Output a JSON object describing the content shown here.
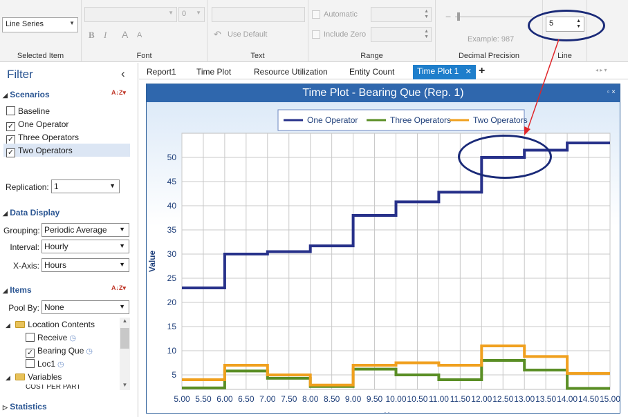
{
  "ribbon": {
    "selected_item": {
      "value": "Line Series",
      "label": "Selected Item"
    },
    "font": {
      "size_value": "0",
      "bold": "B",
      "italic": "I",
      "grow": "A",
      "shrink": "A",
      "label": "Font"
    },
    "text": {
      "use_default": "Use Default",
      "label": "Text"
    },
    "range": {
      "automatic": "Automatic",
      "include_zero": "Include Zero",
      "label": "Range"
    },
    "decimal": {
      "example": "Example: 987",
      "label": "Decimal Precision"
    },
    "line": {
      "value": "5",
      "label": "Line"
    }
  },
  "filter": {
    "title": "Filter",
    "collapse": "‹",
    "scenarios_label": "Scenarios",
    "sort_glyph": "A↓Z",
    "scenarios": [
      {
        "name": "Baseline",
        "checked": false
      },
      {
        "name": "One Operator",
        "checked": true
      },
      {
        "name": "Three Operators",
        "checked": true
      },
      {
        "name": "Two Operators",
        "checked": true,
        "selected": true
      }
    ],
    "replication_label": "Replication:",
    "replication_value": "1",
    "data_display_label": "Data Display",
    "grouping_label": "Grouping:",
    "grouping_value": "Periodic Average",
    "interval_label": "Interval:",
    "interval_value": "Hourly",
    "xaxis_label": "X-Axis:",
    "xaxis_value": "Hours",
    "items_label": "Items",
    "poolby_label": "Pool By:",
    "poolby_value": "None",
    "tree": {
      "location_contents": "Location Contents",
      "receive": "Receive",
      "bearing_que": "Bearing Que",
      "loc1": "Loc1",
      "variables": "Variables",
      "cost_per_part": "COST PER PART"
    },
    "statistics_label": "Statistics"
  },
  "tabs": [
    {
      "label": "Report1"
    },
    {
      "label": "Time Plot"
    },
    {
      "label": "Resource Utilization"
    },
    {
      "label": "Entity Count"
    },
    {
      "label": "Time Plot 1",
      "active": true
    }
  ],
  "tab_close": "✕",
  "tab_add": "+",
  "chart_data": {
    "type": "line",
    "title": "Time Plot - Bearing Que (Rep. 1)",
    "xlabel": "Hours",
    "ylabel": "Value",
    "xlim": [
      5.0,
      15.0
    ],
    "ylim": [
      2,
      55
    ],
    "xticks": [
      "5.00",
      "5.50",
      "6.00",
      "6.50",
      "7.00",
      "7.50",
      "8.00",
      "8.50",
      "9.00",
      "9.50",
      "10.00",
      "10.50",
      "11.00",
      "11.50",
      "12.00",
      "12.50",
      "13.00",
      "13.50",
      "14.00",
      "14.50",
      "15.00"
    ],
    "yticks": [
      5,
      10,
      15,
      20,
      25,
      30,
      35,
      40,
      45,
      50
    ],
    "legend_position": "top-center",
    "grid": true,
    "step": true,
    "x": [
      5,
      6,
      7,
      8,
      9,
      10,
      11,
      12,
      13,
      14
    ],
    "x_end": 15,
    "series": [
      {
        "name": "One Operator",
        "color": "#27318a",
        "values": [
          23,
          30,
          30.5,
          31.7,
          38,
          40.8,
          42.8,
          50,
          51.5,
          53
        ]
      },
      {
        "name": "Three Operators",
        "color": "#5a8e25",
        "values": [
          2.3,
          5.8,
          4.3,
          2.6,
          6.2,
          5,
          4,
          8,
          6,
          2.2
        ]
      },
      {
        "name": "Two Operators",
        "color": "#f0a01e",
        "values": [
          4,
          7,
          5,
          2.9,
          7,
          7.5,
          7,
          11,
          8.8,
          5.3
        ]
      }
    ]
  }
}
